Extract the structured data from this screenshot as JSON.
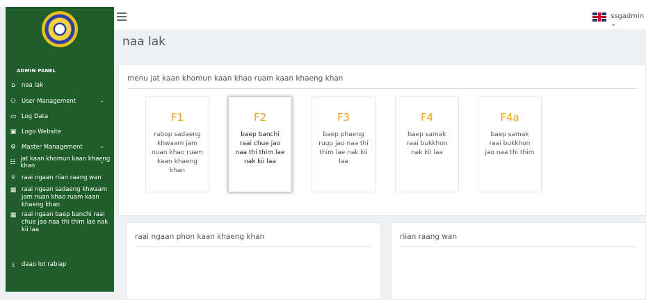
{
  "header": {
    "user_label": "ssgadmin ⌄",
    "page_title": "naa lak"
  },
  "sidebar": {
    "panel_label": "ADMIN PANEL",
    "items": [
      {
        "label": "naa lak",
        "icon": "home-icon"
      },
      {
        "label": "User Management",
        "icon": "users-icon"
      },
      {
        "label": "Log Data",
        "icon": "monitor-icon"
      },
      {
        "label": "Logo Website",
        "icon": "image-icon"
      },
      {
        "label": "Master Management",
        "icon": "cogs-icon"
      },
      {
        "label": "jat kaan khomun kaan khaeng khan",
        "icon": "sitemap-icon"
      },
      {
        "label": "raai ngaan riian raang wan",
        "icon": "trophy-icon"
      },
      {
        "label": "raai ngaan sadaeng khwaam jam nuan khao ruam kaan khaeng khan",
        "icon": "table-icon"
      },
      {
        "label": "raai ngaan baep banchi raai chue jao naa thi thim lae nak kii laa",
        "icon": "table-icon"
      },
      {
        "label": "daao lot rabiap",
        "icon": "download-icon"
      }
    ]
  },
  "main": {
    "menu_panel_title": "menu jat kaan khomun kaan khao ruam kaan khaeng khan",
    "cards": [
      {
        "code": "F1",
        "desc": "rabop sadaeng khwaam jam nuan khao ruam kaan khaeng khan"
      },
      {
        "code": "F2",
        "desc": "baep banchi raai chue jao naa thi thim lae nak kii laa"
      },
      {
        "code": "F3",
        "desc": "baep phaeng ruup jao naa thi thim lae nak kii laa"
      },
      {
        "code": "F4",
        "desc": "baep samak raai bukkhon nak kii laa"
      },
      {
        "code": "F4a",
        "desc": "baep samak raai bukkhon jao naa thi thim"
      }
    ],
    "results_title": "raai ngaan phon kaan khaeng khan",
    "medals_title": "riian raang wan"
  },
  "colors": {
    "sidebar_bg": "#1f5e2b",
    "card_code": "#f2a31b",
    "page_bg": "#eef1f4"
  }
}
